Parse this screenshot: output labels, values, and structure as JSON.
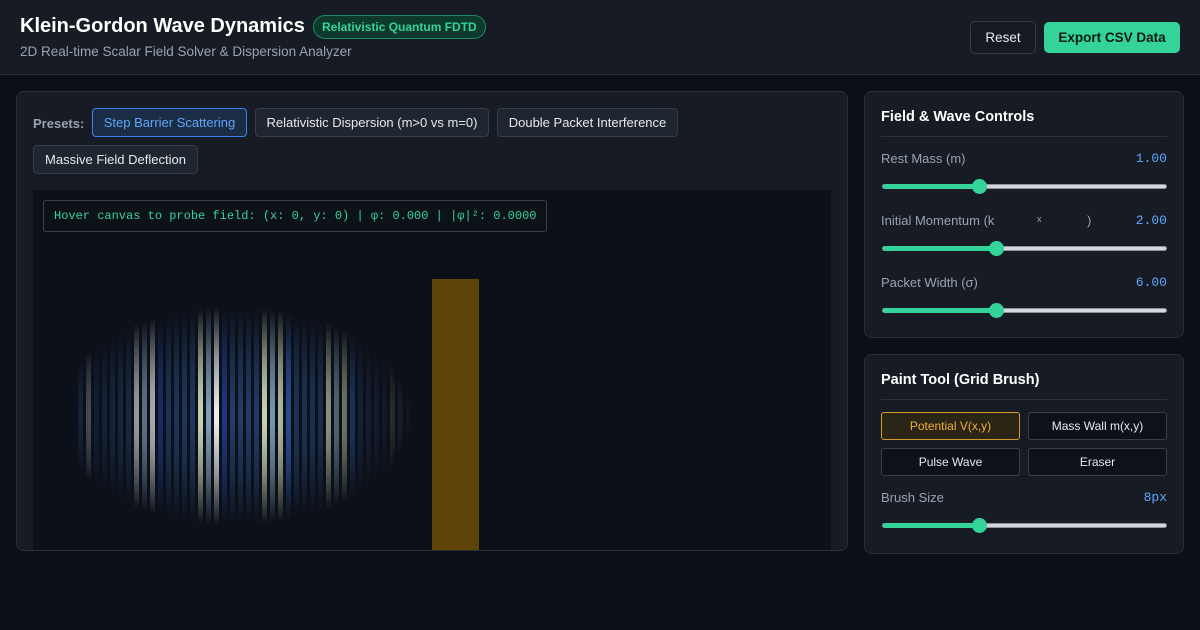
{
  "header": {
    "title": "Klein-Gordon Wave Dynamics",
    "badge": "Relativistic Quantum FDTD",
    "subtitle": "2D Real-time Scalar Field Solver & Dispersion Analyzer",
    "reset_label": "Reset",
    "export_label": "Export CSV Data"
  },
  "presets": {
    "label": "Presets:",
    "items": [
      {
        "label": "Step Barrier Scattering",
        "active": true
      },
      {
        "label": "Relativistic Dispersion (m>0 vs m=0)",
        "active": false
      },
      {
        "label": "Double Packet Interference",
        "active": false
      },
      {
        "label": "Massive Field Deflection",
        "active": false
      }
    ]
  },
  "canvas": {
    "probe_text": "Hover canvas to probe field: (x: 0, y: 0) | φ: 0.000 | |φ|²: 0.0000"
  },
  "field_controls": {
    "title": "Field & Wave Controls",
    "rest_mass": {
      "label": "Rest Mass (m)",
      "value": "1.00",
      "fraction": 0.34
    },
    "momentum": {
      "label": "Initial Momentum (k",
      "sub": "x",
      "close": ")",
      "value": "2.00",
      "fraction": 0.4
    },
    "packet_width": {
      "label": "Packet Width (σ)",
      "value": "6.00",
      "fraction": 0.4
    }
  },
  "paint_tool": {
    "title": "Paint Tool (Grid Brush)",
    "tools": [
      {
        "label": "Potential V(x,y)",
        "active": true
      },
      {
        "label": "Mass Wall m(x,y)",
        "active": false
      },
      {
        "label": "Pulse Wave",
        "active": false
      },
      {
        "label": "Eraser",
        "active": false
      }
    ],
    "brush": {
      "label": "Brush Size",
      "value": "8px",
      "fraction": 0.34
    }
  },
  "colors": {
    "accent": "#34d399",
    "value_blue": "#60a5fa",
    "barrier": "#5e4408",
    "active_tool": "#f0b037"
  }
}
